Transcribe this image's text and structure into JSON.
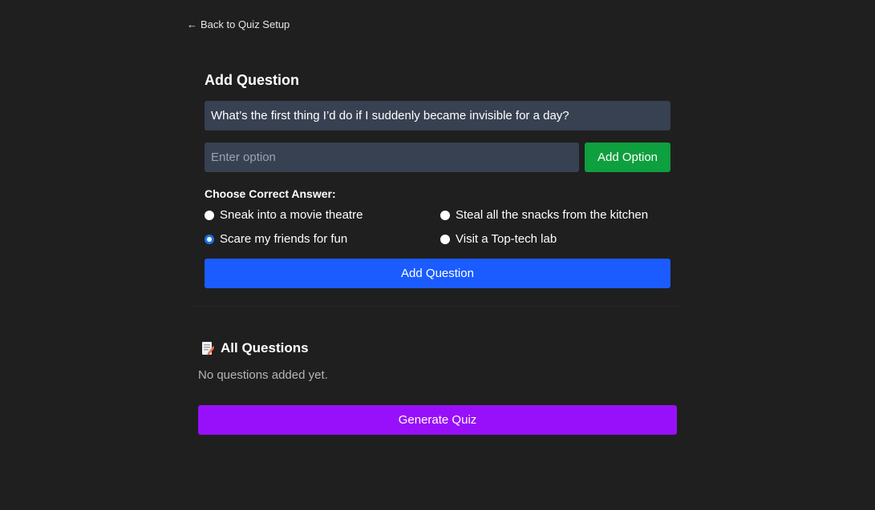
{
  "nav": {
    "back_arrow": "←",
    "back_label": "Back to Quiz Setup"
  },
  "form": {
    "title": "Add Question",
    "question_value": "What’s the first thing I’d do if I suddenly became invisible for a day?",
    "option_placeholder": "Enter option",
    "option_value": "",
    "add_option_label": "Add Option",
    "choose_label": "Choose Correct Answer:",
    "answers": [
      {
        "label": "Sneak into a movie theatre",
        "selected": false
      },
      {
        "label": "Steal all the snacks from the kitchen",
        "selected": false
      },
      {
        "label": "Scare my friends for fun",
        "selected": true
      },
      {
        "label": "Visit a Top-tech lab",
        "selected": false
      }
    ],
    "add_question_label": "Add Question"
  },
  "questions": {
    "icon": "memo-icon",
    "title": "All Questions",
    "empty_text": "No questions added yet."
  },
  "generate_label": "Generate Quiz",
  "colors": {
    "background": "#1f1f1f",
    "input_bg": "#374151",
    "add_option": "#0e9f3e",
    "add_question": "#1a5cff",
    "generate": "#9810fa",
    "radio_selected": "#1a73e8"
  }
}
